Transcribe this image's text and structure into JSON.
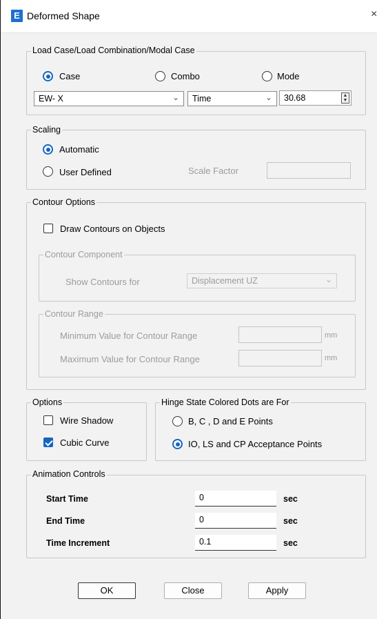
{
  "window": {
    "title": "Deformed Shape",
    "icon_letter": "E",
    "close_glyph": "×"
  },
  "load_case": {
    "group_title": "Load Case/Load Combination/Modal Case",
    "radio_case": "Case",
    "radio_combo": "Combo",
    "radio_mode": "Mode",
    "selected_radio": "Case",
    "case_value": "EW- X",
    "time_value": "Time",
    "step_value": "30.68"
  },
  "scaling": {
    "group_title": "Scaling",
    "automatic": "Automatic",
    "user_defined": "User Defined",
    "selected": "Automatic",
    "scale_factor_label": "Scale Factor",
    "scale_factor_value": ""
  },
  "contour": {
    "group_title": "Contour Options",
    "draw_contours": "Draw Contours on Objects",
    "draw_contours_checked": false,
    "component_title": "Contour Component",
    "show_contours_for": "Show Contours for",
    "component_value": "Displacement UZ",
    "range_title": "Contour Range",
    "min_label": "Minimum Value for Contour Range",
    "max_label": "Maximum Value for Contour Range",
    "min_value": "",
    "max_value": "",
    "unit": "mm"
  },
  "options": {
    "group_title": "Options",
    "wire_shadow": "Wire Shadow",
    "wire_shadow_checked": false,
    "cubic_curve": "Cubic Curve",
    "cubic_curve_checked": true
  },
  "hinge": {
    "group_title": "Hinge State Colored Dots are For",
    "bcde": "B, C , D and E Points",
    "io_ls_cp": "IO, LS and CP Acceptance Points",
    "selected": "IO, LS and CP Acceptance Points"
  },
  "animation": {
    "group_title": "Animation Controls",
    "start_label": "Start Time",
    "start_value": "0",
    "end_label": "End Time",
    "end_value": "0",
    "increment_label": "Time Increment",
    "increment_value": "0.1",
    "unit": "sec"
  },
  "buttons": {
    "ok": "OK",
    "close": "Close",
    "apply": "Apply"
  },
  "colors": {
    "accent": "#1565c0",
    "disabled_text": "#9c9c9c",
    "dialog_bg": "#f2f2f2"
  }
}
